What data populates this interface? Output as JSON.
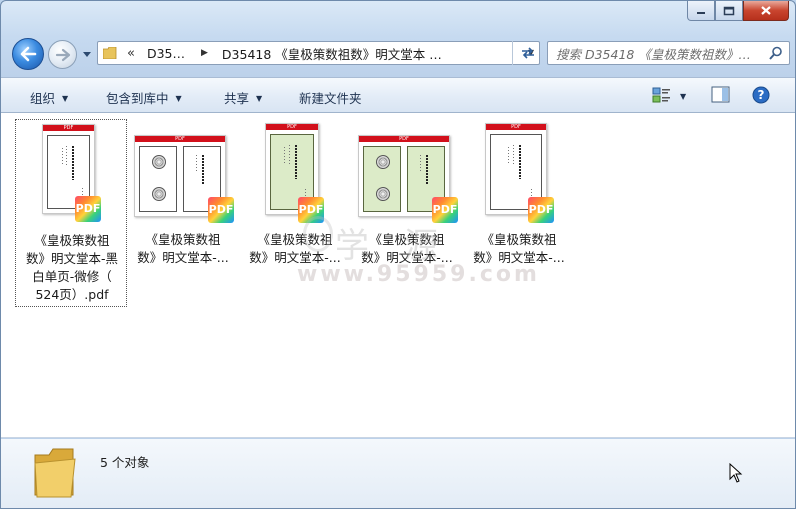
{
  "window": {
    "caption_buttons": [
      "minimize",
      "maximize",
      "close"
    ]
  },
  "navigation": {
    "back_icon": "back-arrow-icon",
    "forward_icon": "forward-arrow-icon",
    "breadcrumb_overflow": "«",
    "breadcrumb_segment_1": "D35…",
    "breadcrumb_segment_2": "D35418 《皇极策数祖数》明文堂本 …",
    "search_placeholder": "搜索 D35418 《皇极策数祖数》…"
  },
  "toolbar": {
    "organize": "组织",
    "include_in_library": "包含到库中",
    "share": "共享",
    "new_folder": "新建文件夹"
  },
  "files": [
    {
      "line1": "《皇极策数祖",
      "line2": "数》明文堂本-黑",
      "line3": "白单页-微修（",
      "line4": "524页）.pdf",
      "badge": "PDF",
      "thumb": "white-single"
    },
    {
      "line1": "《皇极策数祖",
      "line2": "数》明文堂本-...",
      "badge": "PDF",
      "thumb": "white-double"
    },
    {
      "line1": "《皇极策数祖",
      "line2": "数》明文堂本-...",
      "badge": "PDF",
      "thumb": "green-single"
    },
    {
      "line1": "《皇极策数祖",
      "line2": "数》明文堂本-...",
      "badge": "PDF",
      "thumb": "green-double"
    },
    {
      "line1": "《皇极策数祖",
      "line2": "数》明文堂本-...",
      "badge": "PDF",
      "thumb": "white-single"
    }
  ],
  "pdf_bar_text": "PDF",
  "watermark": {
    "text": "学 源",
    "url": "www.95959.com"
  },
  "status": {
    "count_text": "5 个对象"
  },
  "colors": {
    "pdf_red": "#d2101b",
    "green_page": "#dcebc8",
    "address_text": "#1b1b1b"
  }
}
